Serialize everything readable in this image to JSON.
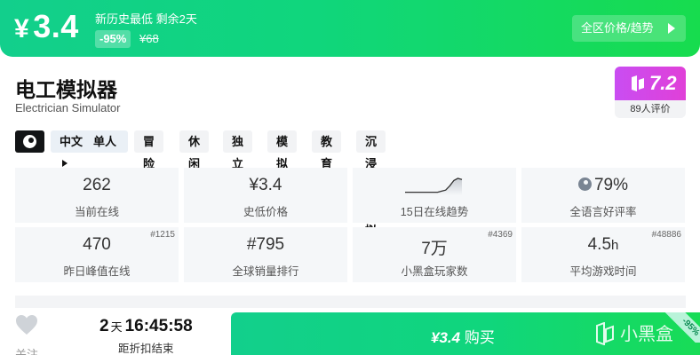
{
  "banner": {
    "price": "¥3.4",
    "price_symbol": "¥",
    "price_value": "3.4",
    "note": "新历史最低 剩余2天",
    "discount": "-95%",
    "original_price": "¥68",
    "region_button": "全区价格/趋势"
  },
  "game": {
    "title": "电工模拟器",
    "subtitle": "Electrician Simulator"
  },
  "score": {
    "value": "7.2",
    "count_label": "89人评价"
  },
  "tags": {
    "platform_icon": "steam-icon",
    "language": "中文",
    "mode": "单人",
    "genres": [
      "冒险",
      "休闲",
      "独立",
      "模拟",
      "教育",
      "沉浸式模拟"
    ]
  },
  "stats": {
    "online": {
      "value": "262",
      "label": "当前在线"
    },
    "lowest": {
      "value": "¥3.4",
      "label": "史低价格"
    },
    "trend": {
      "label": "15日在线趋势",
      "points": [
        2,
        2,
        2,
        2,
        2,
        2,
        2,
        2,
        2,
        3,
        4,
        8,
        13,
        15,
        14
      ]
    },
    "rating": {
      "value": "79%",
      "label": "全语言好评率"
    },
    "peak": {
      "value": "470",
      "label": "昨日峰值在线",
      "rank": "#1215"
    },
    "sales": {
      "value": "#795",
      "label": "全球销量排行"
    },
    "players": {
      "value": "7万",
      "label": "小黑盒玩家数",
      "rank": "#4369"
    },
    "playtime": {
      "value": "4.5",
      "unit": "h",
      "label": "平均游戏时间",
      "rank": "#48886"
    }
  },
  "bottom": {
    "favorite_label": "关注",
    "countdown_days": "2",
    "countdown_day_unit": "天",
    "countdown_time": "16:45:58",
    "countdown_label": "距折扣结束",
    "buy_price": "¥3.4",
    "buy_label": "购买",
    "brand": "小黑盒",
    "corner_discount": "-95%"
  },
  "colors": {
    "brand_green": "#10d67c",
    "score_purple": "#d946ef"
  }
}
